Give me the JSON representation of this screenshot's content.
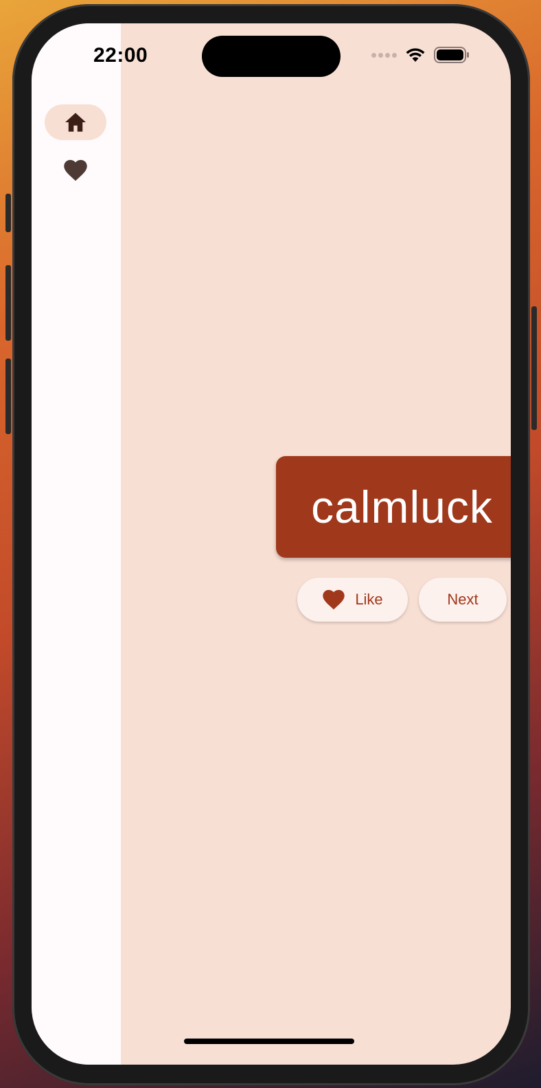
{
  "status_bar": {
    "time": "22:00"
  },
  "nav_rail": {
    "items": [
      {
        "icon": "home-icon",
        "selected": true
      },
      {
        "icon": "heart-icon",
        "selected": false
      }
    ]
  },
  "main": {
    "word": "calmluck",
    "like_label": "Like",
    "next_label": "Next"
  },
  "colors": {
    "accent": "#a0381b",
    "background": "#f8dfd4",
    "rail": "#fffbfc",
    "button_bg": "#fdf1ee"
  }
}
